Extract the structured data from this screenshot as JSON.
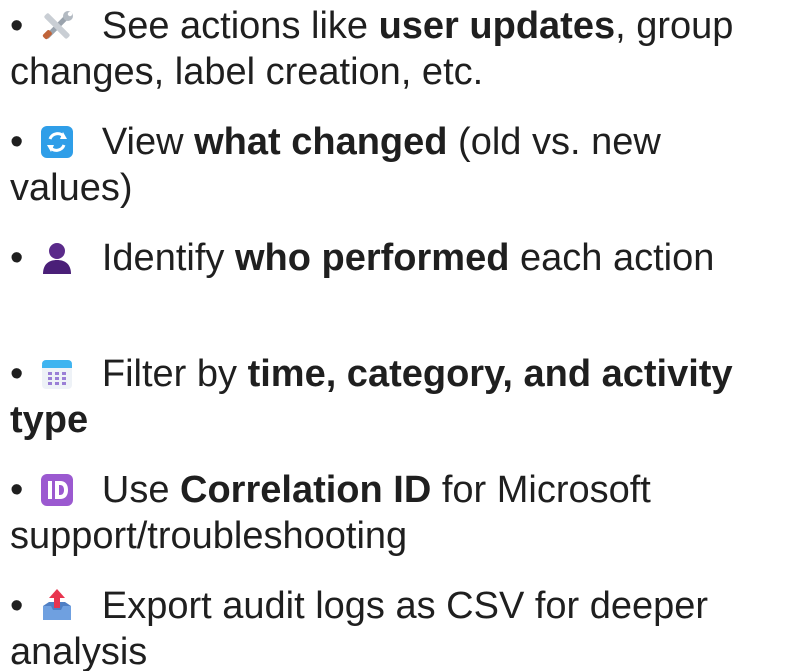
{
  "items": [
    {
      "icon": "tools-icon",
      "pre": " See actions like ",
      "bold": "user updates",
      "post": ", group changes, label creation, etc."
    },
    {
      "icon": "refresh-arrows-icon",
      "pre": " View ",
      "bold": "what changed",
      "post": " (old vs. new values)"
    },
    {
      "icon": "person-silhouette-icon",
      "pre": " Identify ",
      "bold": "who performed",
      "post": " each action"
    },
    {
      "icon": "calendar-icon",
      "pre": " Filter by ",
      "bold": "time, category, and activity type",
      "post": ""
    },
    {
      "icon": "id-button-icon",
      "pre": " Use ",
      "bold": "Correlation ID",
      "post": " for Microsoft support/troubleshooting"
    },
    {
      "icon": "outbox-tray-icon",
      "pre": " Export audit logs as CSV for deeper analysis",
      "bold": "",
      "post": ""
    }
  ],
  "bullet_char": "•",
  "colors": {
    "text": "#1f1f1f",
    "refresh_icon": "#2f9ee8",
    "person_icon": "#5a2a8a",
    "id_icon": "#9b59d0",
    "calendar_header": "#3fb4f0",
    "outbox_arrow": "#e8344e"
  }
}
